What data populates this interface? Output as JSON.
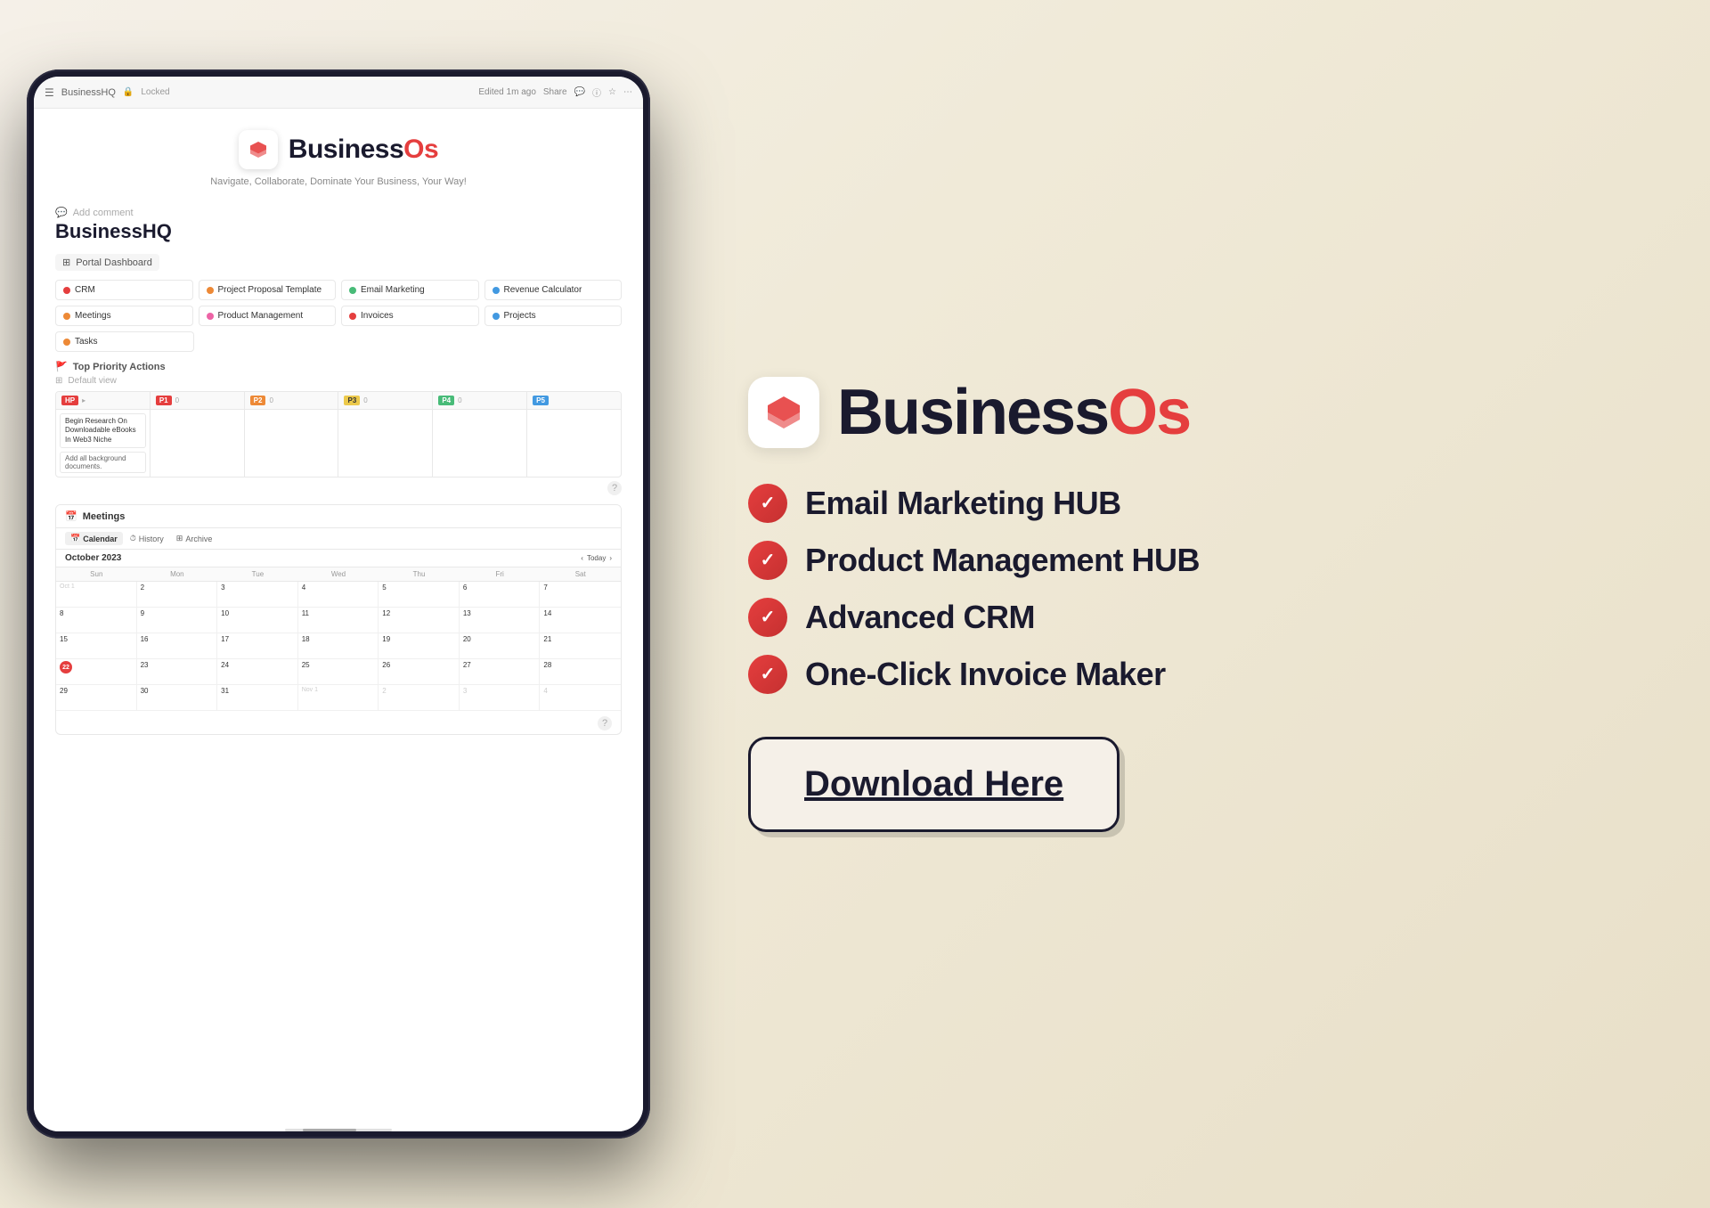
{
  "page": {
    "bg": "#f5f0e8"
  },
  "tablet": {
    "topbar": {
      "left_text": "BusinessHQ",
      "lock_label": "Locked",
      "edited_label": "Edited 1m ago",
      "share_label": "Share"
    },
    "header": {
      "brand_prefix": "Business",
      "brand_suffix": "Os",
      "subtitle": "Navigate, Collaborate, Dominate Your Business, Your Way!"
    },
    "content": {
      "add_comment": "Add comment",
      "page_title": "BusinessHQ",
      "portal_dashboard": "Portal Dashboard",
      "links_row1": [
        {
          "label": "CRM",
          "color": "red"
        },
        {
          "label": "Project Proposal Template",
          "color": "orange"
        },
        {
          "label": "Email Marketing",
          "color": "green"
        },
        {
          "label": "Revenue Calculator",
          "color": "blue"
        }
      ],
      "links_row2": [
        {
          "label": "Meetings",
          "color": "orange"
        },
        {
          "label": "Product Management",
          "color": "pink"
        },
        {
          "label": "Invoices",
          "color": "red"
        },
        {
          "label": "Projects",
          "color": "blue"
        }
      ],
      "links_row3": [
        {
          "label": "Tasks",
          "color": "orange"
        }
      ],
      "priority_section": "Top Priority Actions",
      "default_view": "Default view",
      "kanban_cols": [
        {
          "badge": "HP",
          "count": ""
        },
        {
          "badge": "P1",
          "count": "0"
        },
        {
          "badge": "P2",
          "count": "0"
        },
        {
          "badge": "P3",
          "count": "0"
        },
        {
          "badge": "P4",
          "count": "0"
        },
        {
          "badge": "P5",
          "count": ""
        }
      ],
      "kanban_card1": "Begin Research On Downloadable eBooks In Web3 Niche",
      "kanban_card2": "Add all background documents.",
      "meetings_label": "Meetings",
      "calendar_tabs": [
        "Calendar",
        "History",
        "Archive"
      ],
      "active_tab": "Calendar",
      "month_title": "October 2023",
      "today_btn": "Today",
      "day_labels": [
        "Sun",
        "Mon",
        "Tue",
        "Wed",
        "Thu",
        "Fri",
        "Sat"
      ],
      "weeks": [
        [
          "",
          "2",
          "3",
          "4",
          "5",
          "6",
          "7"
        ],
        [
          "8",
          "9",
          "10",
          "11",
          "12",
          "13",
          "14"
        ],
        [
          "15",
          "16",
          "17",
          "18",
          "19",
          "20",
          "21"
        ],
        [
          "22",
          "23",
          "24",
          "25",
          "26",
          "27",
          "28"
        ],
        [
          "29",
          "30",
          "31",
          "Nov 1",
          "2",
          "3",
          "4"
        ]
      ],
      "oct1": "Oct 1",
      "today_date": "22"
    }
  },
  "right": {
    "brand_prefix": "Business",
    "brand_suffix": "Os",
    "features": [
      "Email Marketing HUB",
      "Product Management HUB",
      "Advanced CRM",
      "One-Click Invoice Maker"
    ],
    "download_btn": "Download Here"
  }
}
